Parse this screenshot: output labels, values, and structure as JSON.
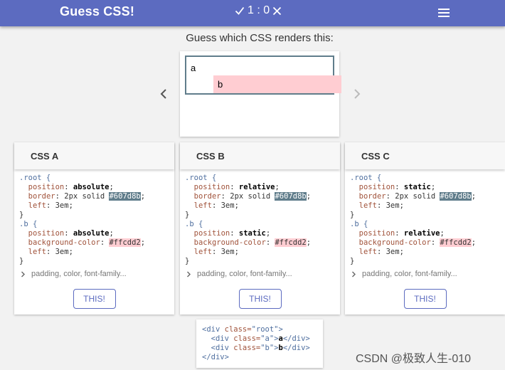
{
  "appbar": {
    "title": "Guess CSS!",
    "score": "1 : 0",
    "check_icon": "check-icon",
    "cross_icon": "close-icon",
    "menu_icon": "hamburger-menu-icon",
    "color": "#5c6bc0"
  },
  "prompt": "Guess which CSS renders this:",
  "preview": {
    "a_text": "a",
    "b_text": "b"
  },
  "nav": {
    "prev_icon": "chevron-left-icon",
    "next_icon": "chevron-right-icon"
  },
  "cards": [
    {
      "title": "CSS A",
      "root_selector": ".root {",
      "root_position": "absolute",
      "border_value": "2px solid",
      "border_color": "#607d8b",
      "root_left": "3em",
      "b_selector": ".b {",
      "b_position": "absolute",
      "bg_color": "#ffcdd2",
      "b_left": "3em",
      "more_text": "padding, color, font-family...",
      "button_label": "THIS!"
    },
    {
      "title": "CSS B",
      "root_selector": ".root {",
      "root_position": "relative",
      "border_value": "2px solid",
      "border_color": "#607d8b",
      "root_left": "3em",
      "b_selector": ".b {",
      "b_position": "static",
      "bg_color": "#ffcdd2",
      "b_left": "3em",
      "more_text": "padding, color, font-family...",
      "button_label": "THIS!"
    },
    {
      "title": "CSS C",
      "root_selector": ".root {",
      "root_position": "static",
      "border_value": "2px solid",
      "border_color": "#607d8b",
      "root_left": "3em",
      "b_selector": ".b {",
      "b_position": "relative",
      "bg_color": "#ffcdd2",
      "b_left": "3em",
      "more_text": "padding, color, font-family...",
      "button_label": "THIS!"
    }
  ],
  "html_snippet": {
    "root_tag_open": "<div",
    "root_attr": "class=",
    "root_value": "\"root\"",
    "a_value": "\"a\"",
    "a_text": "a",
    "b_value": "\"b\"",
    "b_text": "b",
    "close_tag": "</div>"
  },
  "watermark": "CSDN @极致人生-010"
}
